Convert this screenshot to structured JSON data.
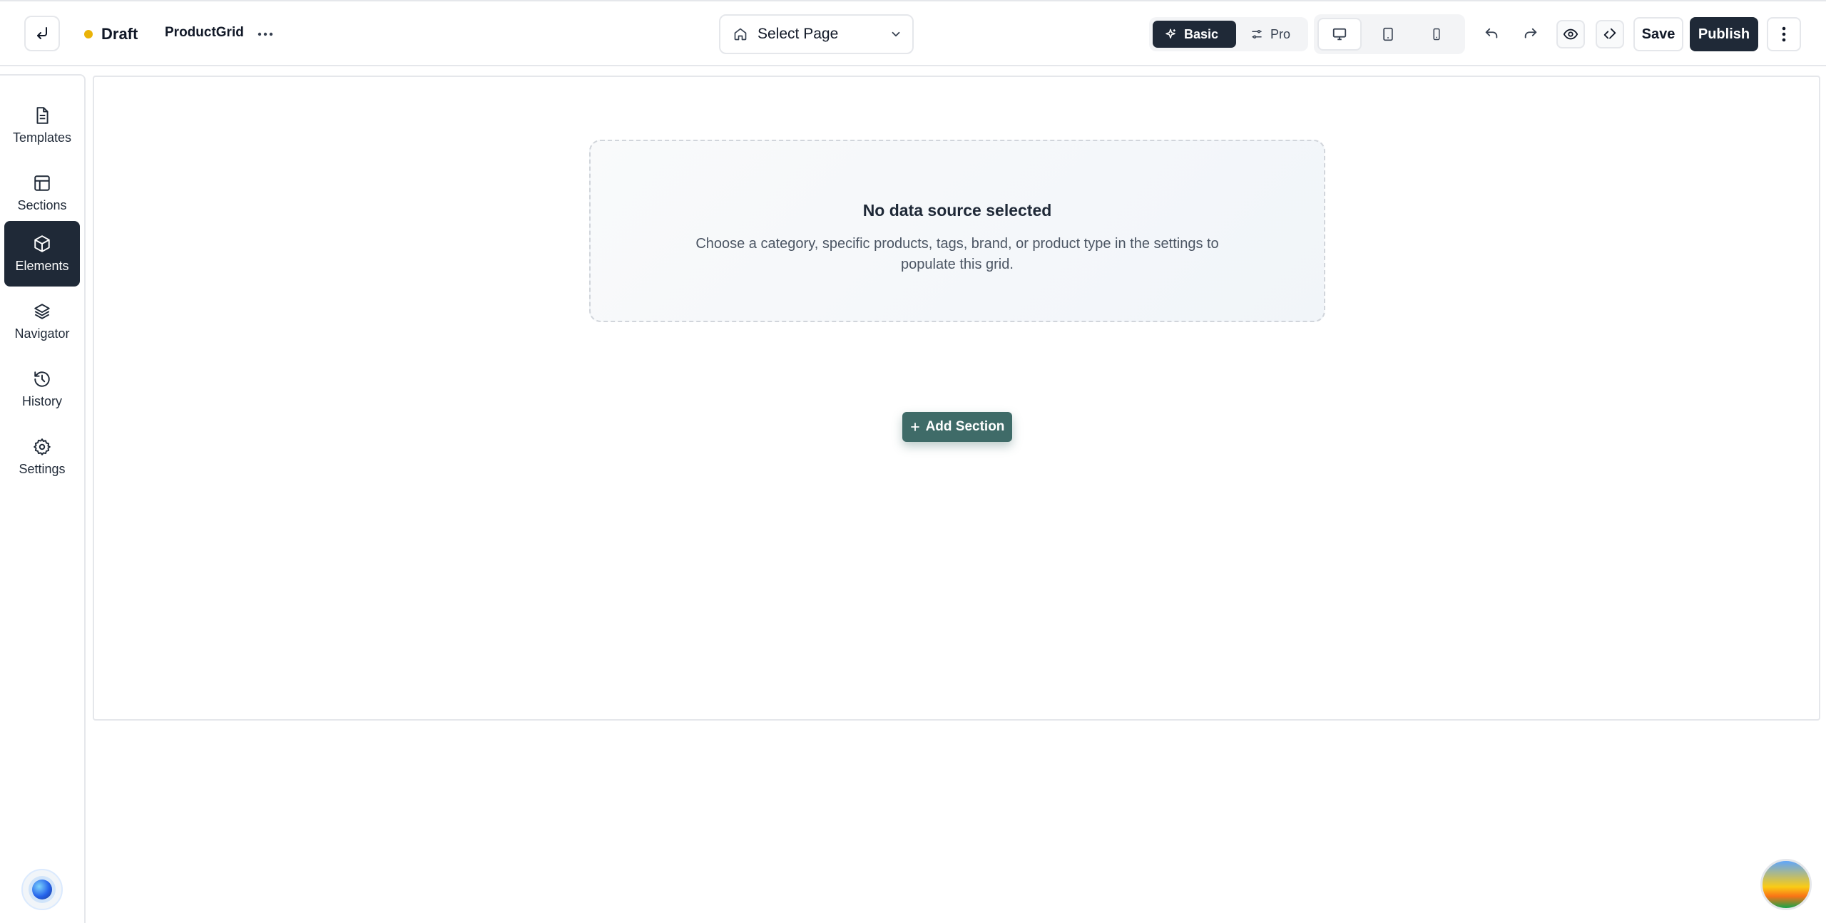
{
  "header": {
    "status": "Draft",
    "status_color": "#eab308",
    "page_name": "ProductGrid",
    "page_select": {
      "label": "Select Page",
      "icon": "home-icon"
    },
    "mode": {
      "basic": "Basic",
      "pro": "Pro",
      "selected": "Basic"
    },
    "devices": [
      "desktop",
      "tablet",
      "mobile"
    ],
    "active_device": "desktop",
    "save_label": "Save",
    "publish_label": "Publish"
  },
  "sidebar": {
    "items": [
      {
        "label": "Templates",
        "icon": "document-icon",
        "active": false
      },
      {
        "label": "Sections",
        "icon": "layout-icon",
        "active": false
      },
      {
        "label": "Elements",
        "icon": "cube-icon",
        "active": true
      },
      {
        "label": "Navigator",
        "icon": "layers-icon",
        "active": false
      },
      {
        "label": "History",
        "icon": "history-icon",
        "active": false
      },
      {
        "label": "Settings",
        "icon": "gear-icon",
        "active": false
      }
    ]
  },
  "canvas": {
    "empty_state": {
      "title": "No data source selected",
      "description": "Choose a category, specific products, tags, brand, or product type in the settings to populate this grid."
    },
    "add_section_label": "Add Section"
  },
  "colors": {
    "primary_dark": "#1f2937",
    "add_section": "#3f6b68"
  }
}
